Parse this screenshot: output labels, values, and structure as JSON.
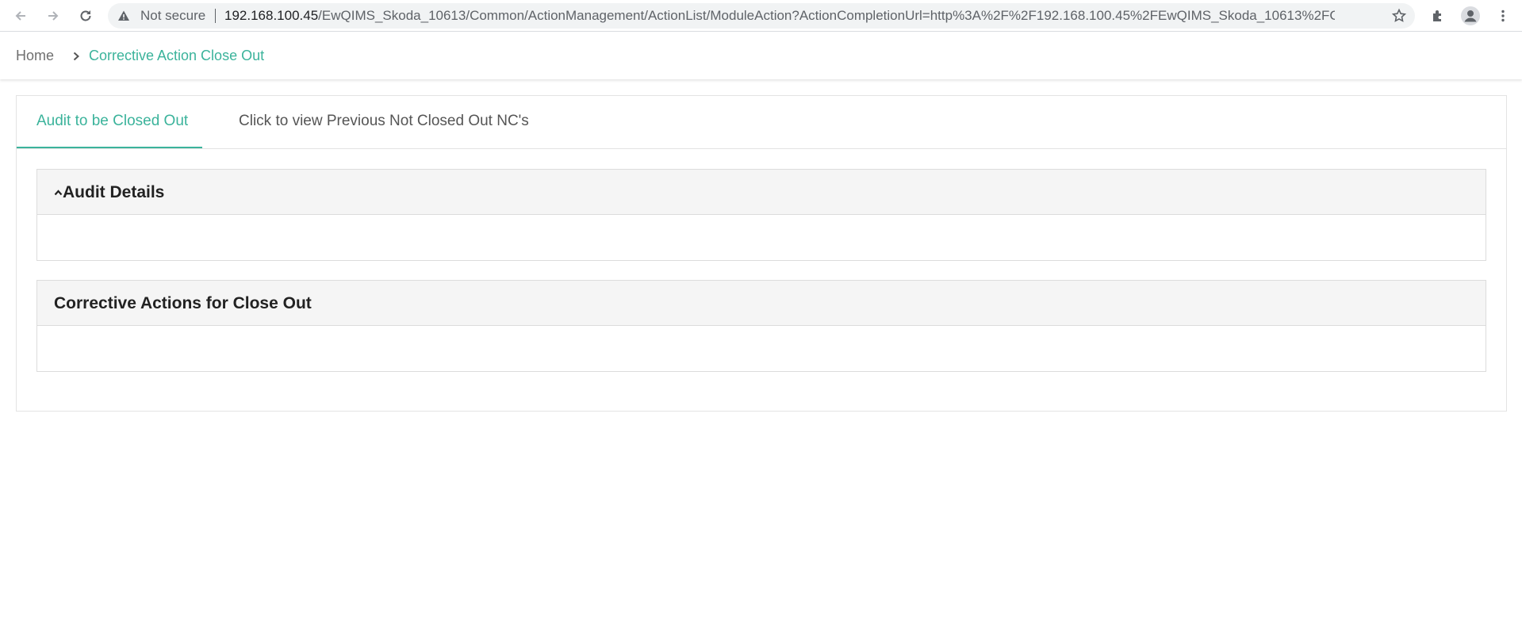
{
  "browser": {
    "security_label": "Not secure",
    "url_host": "192.168.100.45",
    "url_path": "/EwQIMS_Skoda_10613/Common/ActionManagement/ActionList/ModuleAction?ActionCompletionUrl=http%3A%2F%2F192.168.100.45%2FEwQIMS_Skoda_10613%2FCom...",
    "icons": [
      "back-icon",
      "forward-icon",
      "reload-icon",
      "warning-icon",
      "star-icon",
      "extensions-icon",
      "profile-icon",
      "menu-icon"
    ]
  },
  "breadcrumb": {
    "home": "Home",
    "current": "Corrective Action Close Out"
  },
  "tabs": [
    {
      "label": "Audit to be Closed Out",
      "active": true
    },
    {
      "label": "Click to view Previous Not Closed Out NC's",
      "active": false
    }
  ],
  "panels": [
    {
      "title": "Audit Details",
      "collapsible": true
    },
    {
      "title": "Corrective Actions for Close Out",
      "collapsible": false
    }
  ],
  "colors": {
    "accent": "#3bb39b",
    "panel_header_bg": "#f5f5f5",
    "border": "#e3e3e3"
  }
}
